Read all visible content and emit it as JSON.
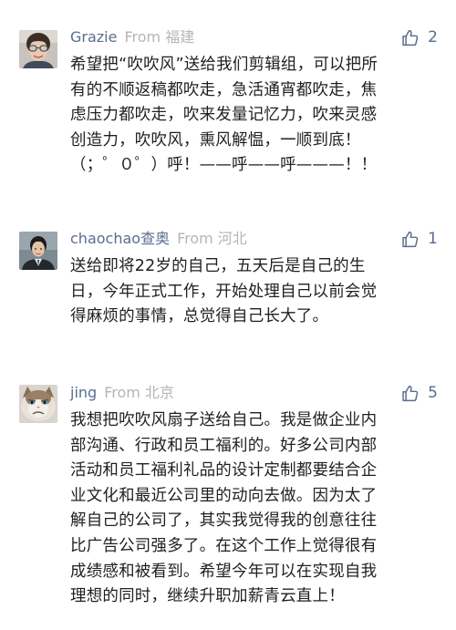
{
  "comments": [
    {
      "user": "Grazie",
      "from": "From 福建",
      "likes": "2",
      "avatar_icon": "avatar-woman-glasses",
      "lines": [
        "希望把“吹吹风”送给我们剪辑组，可以把所",
        "有的不顺返稿都吹走，急活通宵都吹走，焦",
        "虑压力都吹走，吹来发量记忆力，吹来灵感",
        "创造力，吹吹风，熏风解愠，一顺到底！",
        "（；゜０゜）呼！——呼——呼———！！"
      ]
    },
    {
      "user": "chaochao查奥",
      "from": "From 河北",
      "likes": "1",
      "avatar_icon": "avatar-man-suit",
      "lines": [
        "送给即将22岁的自己，五天后是自己的生",
        "日，今年正式工作，开始处理自己以前会觉",
        "得麻烦的事情，总觉得自己长大了。"
      ]
    },
    {
      "user": "jing",
      "from": "From 北京",
      "likes": "5",
      "avatar_icon": "avatar-grumpy-cat",
      "lines": [
        "我想把吹吹风扇子送给自己。我是做企业内",
        "部沟通、行政和员工福利的。好多公司内部",
        "活动和员工福利礼品的设计定制都要结合企",
        "业文化和最近公司里的动向去做。因为太了",
        "解自己的公司了，其实我觉得我的创意往往",
        "比广告公司强多了。在这个工作上觉得很有",
        "成绩感和被看到。希望今年可以在实现自我",
        "理想的同时，继续升职加薪青云直上！"
      ]
    }
  ],
  "colors": {
    "username": "#5a6d8f",
    "from": "#b5b5b5",
    "body": "#1f1f1f",
    "like_icon": "#5a6d8f"
  }
}
